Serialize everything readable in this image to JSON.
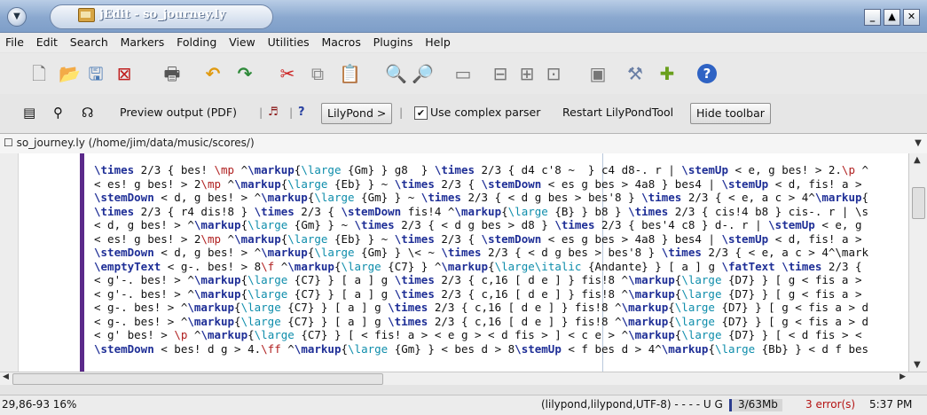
{
  "window": {
    "title": "jEdit - so_journey.ly",
    "buttons": [
      "_",
      "▲",
      "✕"
    ]
  },
  "menu": [
    "File",
    "Edit",
    "Search",
    "Markers",
    "Folding",
    "View",
    "Utilities",
    "Macros",
    "Plugins",
    "Help"
  ],
  "toolbar_icons": [
    {
      "icon": "new-file-icon",
      "glyph": "🗋"
    },
    {
      "icon": "open-file-icon",
      "glyph": "📂"
    },
    {
      "icon": "save-icon",
      "glyph": "🖫"
    },
    {
      "icon": "close-buffer-icon",
      "glyph": "⊠"
    },
    {
      "icon": "print-icon",
      "glyph": "🖶"
    },
    {
      "icon": "undo-icon",
      "glyph": "↶"
    },
    {
      "icon": "redo-icon",
      "glyph": "↷"
    },
    {
      "icon": "cut-icon",
      "glyph": "✂"
    },
    {
      "icon": "copy-icon",
      "glyph": "⧉"
    },
    {
      "icon": "paste-icon",
      "glyph": "📋"
    },
    {
      "icon": "find-icon",
      "glyph": "🔍"
    },
    {
      "icon": "find-next-icon",
      "glyph": "🔎"
    },
    {
      "icon": "new-view-icon",
      "glyph": "▭"
    },
    {
      "icon": "split-horizontal-icon",
      "glyph": "⊟"
    },
    {
      "icon": "split-vertical-icon",
      "glyph": "⊞"
    },
    {
      "icon": "unsplit-icon",
      "glyph": "⊡"
    },
    {
      "icon": "global-options-icon",
      "glyph": "▣"
    },
    {
      "icon": "tools-icon",
      "glyph": "⚒"
    },
    {
      "icon": "plugin-manager-icon",
      "glyph": "✚"
    },
    {
      "icon": "help-icon",
      "glyph": "?"
    }
  ],
  "lilypond_toolbar": {
    "preview_label": "Preview output (PDF)",
    "lilypond_button": "LilyPond >",
    "complex_parser_label": "Use complex parser",
    "complex_parser_checked": true,
    "restart_label": "Restart LilyPondTool",
    "hide_label": "Hide toolbar"
  },
  "buffer_path": "so_journey.ly (/home/jim/data/music/scores/)",
  "code_lines": [
    "\\times 2/3 { bes! \\mp ^\\markup{\\large {Gm} } g8  } \\times 2/3 { d4 c'8 ~  } c4 d8-. r | \\stemUp < e, g bes! > 2.\\p ^",
    "< es! g bes! > 2\\mp ^\\markup{\\large {Eb} } ~ \\times 2/3 { \\stemDown < es g bes > 4a8 } bes4 | \\stemUp < d, fis! a >",
    "\\stemDown < d, g bes! > ^\\markup{\\large {Gm} } ~ \\times 2/3 { < d g bes > bes'8 } \\times 2/3 { < e, a c > 4^\\markup{",
    "\\times 2/3 { r4 dis!8 } \\times 2/3 { \\stemDown fis!4 ^\\markup{\\large {B} } b8 } \\times 2/3 { cis!4 b8 } cis-. r | \\s",
    "< d, g bes! > ^\\markup{\\large {Gm} } ~ \\times 2/3 { < d g bes > d8 } \\times 2/3 { bes'4 c8 } d-. r | \\stemUp < e, g",
    "< es! g bes! > 2\\mp ^\\markup{\\large {Eb} } ~ \\times 2/3 { \\stemDown < es g bes > 4a8 } bes4 | \\stemUp < d, fis! a >",
    "\\stemDown < d, g bes! > ^\\markup{\\large {Gm} } \\< ~ \\times 2/3 { < d g bes > bes'8 } \\times 2/3 { < e, a c > 4^\\mark",
    "\\emptyText < g-. bes! > 8\\f ^\\markup{\\large {C7} } ^\\markup{\\large\\italic {Andante} } [ a ] g \\fatText \\times 2/3 {",
    "< g'-. bes! > ^\\markup{\\large {C7} } [ a ] g \\times 2/3 { c,16 [ d e ] } fis!8 ^\\markup{\\large {D7} } [ g < fis a >",
    "< g'-. bes! > ^\\markup{\\large {C7} } [ a ] g \\times 2/3 { c,16 [ d e ] } fis!8 ^\\markup{\\large {D7} } [ g < fis a >",
    "< g-. bes! > ^\\markup{\\large {C7} } [ a ] g \\times 2/3 { c,16 [ d e ] } fis!8 ^\\markup{\\large {D7} } [ g < fis a > d",
    "< g-. bes! > ^\\markup{\\large {C7} } [ a ] g \\times 2/3 { c,16 [ d e ] } fis!8 ^\\markup{\\large {D7} } [ g < fis a > d",
    "< g' bes! > \\p ^\\markup{\\large {C7} } [ < fis! a > < e g > < d fis > ] < c e > ^\\markup{\\large {D7} } [ < d fis > <",
    "\\stemDown < bes! d g > 4.\\ff ^\\markup{\\large {Gm} } < bes d > 8\\stemUp < f bes d > 4^\\markup{\\large {Bb} } < d f bes"
  ],
  "status": {
    "position": "29,86-93 16%",
    "mode": "(lilypond,lilypond,UTF-8) - - - - U G",
    "memory": "3/63Mb",
    "memory_fraction": 0.05,
    "errors": "3 error(s)",
    "time": "5:37 PM"
  },
  "colors": {
    "keyword": "#1e2e96",
    "markup_arg": "#0e8dab",
    "dynamic": "#b02020",
    "title_gradient_top": "#b9cde6",
    "error_red": "#b41212"
  }
}
